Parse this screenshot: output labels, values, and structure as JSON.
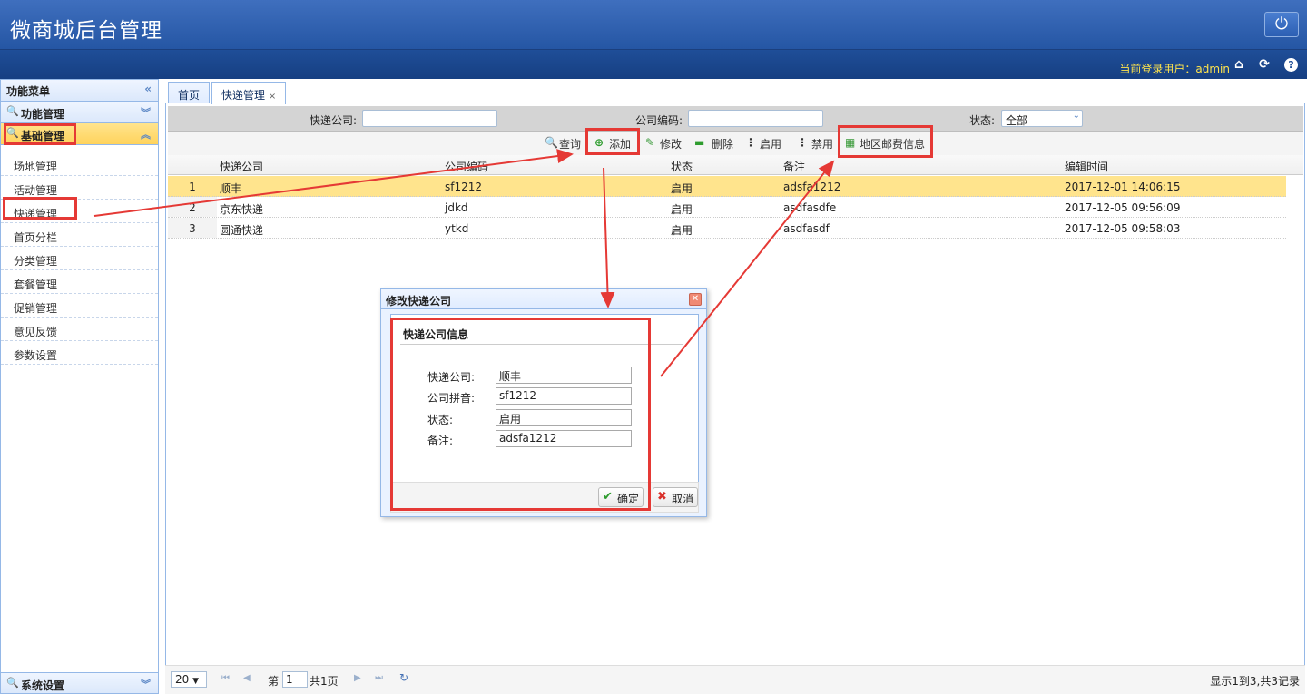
{
  "app": {
    "title": "微商城后台管理"
  },
  "userbar": {
    "current_user_label": "当前登录用户：admin"
  },
  "sidebar": {
    "header": "功能菜单",
    "groups": [
      "功能管理",
      "基础管理"
    ],
    "items": [
      "场地管理",
      "活动管理",
      "快递管理",
      "首页分栏",
      "分类管理",
      "套餐管理",
      "促销管理",
      "意见反馈",
      "参数设置"
    ],
    "bottom_group": "系统设置"
  },
  "tabs": [
    "首页",
    "快递管理"
  ],
  "search": {
    "company_label": "快递公司:",
    "code_label": "公司编码:",
    "status_label": "状态:",
    "status_value": "全部"
  },
  "toolbar": {
    "query": "查询",
    "add": "添加",
    "edit": "修改",
    "delete": "删除",
    "enable": "启用",
    "disable": "禁用",
    "region_fee": "地区邮费信息"
  },
  "grid": {
    "columns": [
      "快递公司",
      "公司编码",
      "状态",
      "备注",
      "编辑时间"
    ],
    "rows": [
      {
        "n": "1",
        "company": "顺丰",
        "code": "sf1212",
        "status": "启用",
        "remark": "adsfa1212",
        "time": "2017-12-01 14:06:15"
      },
      {
        "n": "2",
        "company": "京东快递",
        "code": "jdkd",
        "status": "启用",
        "remark": "asdfasdfe",
        "time": "2017-12-05 09:56:09"
      },
      {
        "n": "3",
        "company": "圆通快递",
        "code": "ytkd",
        "status": "启用",
        "remark": "asdfasdf",
        "time": "2017-12-05 09:58:03"
      }
    ]
  },
  "pager": {
    "page_size": "20",
    "page_prefix": "第",
    "page_value": "1",
    "page_total": "共1页",
    "summary": "显示1到3,共3记录"
  },
  "dialog": {
    "title": "修改快递公司",
    "section_title": "快递公司信息",
    "fields": [
      {
        "label": "快递公司:",
        "value": "顺丰"
      },
      {
        "label": "公司拼音:",
        "value": "sf1212"
      },
      {
        "label": "状态:",
        "value": "启用"
      },
      {
        "label": "备注:",
        "value": "adsfa1212"
      }
    ],
    "ok": "确定",
    "cancel": "取消"
  },
  "colors": {
    "header_blue": "#2b5daf",
    "highlight_row": "#ffe48d",
    "annotation_red": "#e53935",
    "user_text": "#ffe44c"
  }
}
